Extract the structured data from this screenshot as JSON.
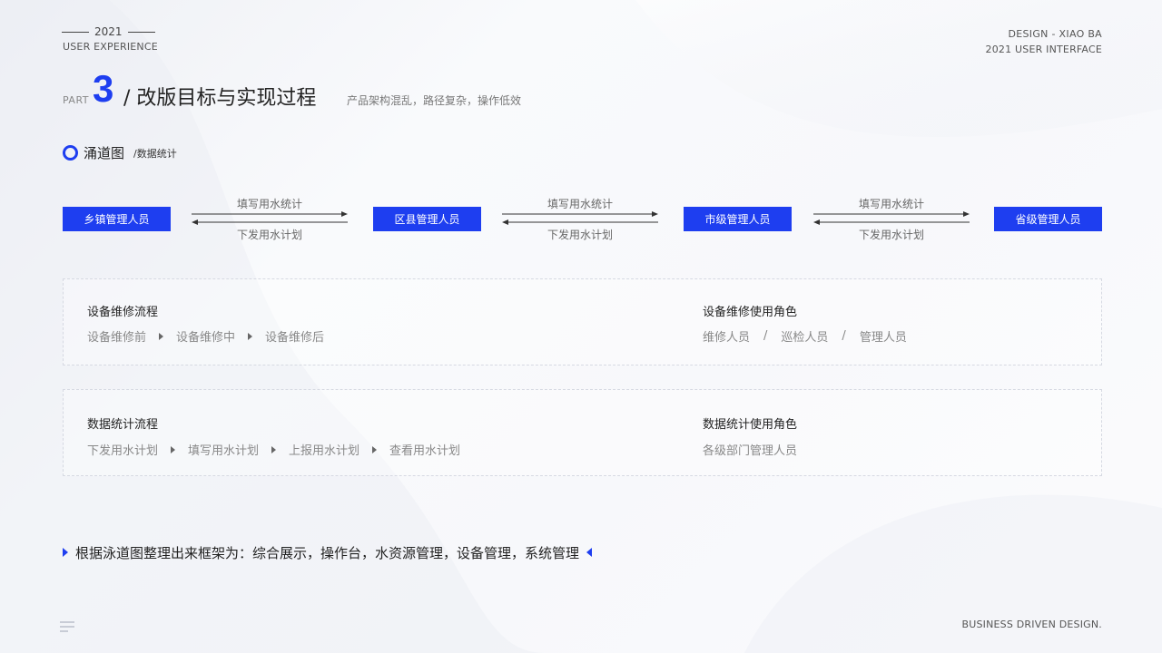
{
  "header": {
    "year": "2021",
    "subtitle": "USER EXPERIENCE",
    "design_credit": "DESIGN - XIAO BA",
    "ui_label": "2021 USER INTERFACE"
  },
  "title": {
    "part_word": "PART",
    "part_number": "3",
    "main": "/ 改版目标与实现过程",
    "sub": "产品架构混乱，路径复杂，操作低效"
  },
  "section": {
    "title": "涌道图",
    "sub": "/数据统计"
  },
  "funnel": {
    "roles": [
      "乡镇管理人员",
      "区县管理人员",
      "市级管理人员",
      "省级管理人员"
    ],
    "flows": [
      {
        "up": "填写用水统计",
        "down": "下发用水计划"
      },
      {
        "up": "填写用水统计",
        "down": "下发用水计划"
      },
      {
        "up": "填写用水统计",
        "down": "下发用水计划"
      }
    ]
  },
  "card1": {
    "left_title": "设备维修流程",
    "steps": [
      "设备维修前",
      "设备维修中",
      "设备维修后"
    ],
    "right_title": "设备维修使用角色",
    "roles": [
      "维修人员",
      "巡检人员",
      "管理人员"
    ],
    "separator": "/"
  },
  "card2": {
    "left_title": "数据统计流程",
    "steps": [
      "下发用水计划",
      "填写用水计划",
      "上报用水计划",
      "查看用水计划"
    ],
    "right_title": "数据统计使用角色",
    "roles_text": "各级部门管理人员"
  },
  "summary": "根据泳道图整理出来框架为：综合展示，操作台，水资源管理，设备管理，系统管理",
  "footer": "BUSINESS DRIVEN DESIGN.",
  "colors": {
    "accent": "#1e3ef0"
  }
}
